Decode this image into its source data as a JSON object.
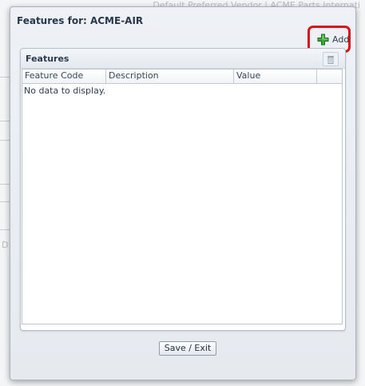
{
  "background": {
    "header_text": "Default Preferred Vendor | ACME Parts Internati"
  },
  "dialog": {
    "title": "Features for: ACME-AIR",
    "add_label": "Add",
    "add_icon": "plus-icon",
    "highlight_color": "#d8131b"
  },
  "panel": {
    "title": "Features",
    "delete_icon": "trash-icon",
    "columns": [
      "Feature Code",
      "Description",
      "Value",
      ""
    ],
    "empty_message": "No data to display."
  },
  "footer": {
    "save_exit_label": "Save / Exit"
  },
  "colors": {
    "accent_green": "#3aa83a",
    "title_text": "#28384a"
  }
}
